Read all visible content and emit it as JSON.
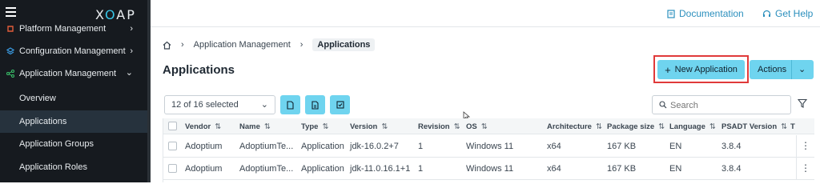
{
  "sidebar": {
    "logo": "XOAP",
    "items": [
      {
        "label": "Platform Management",
        "icon": "platform-icon",
        "color": "#e25c3a"
      },
      {
        "label": "Configuration Management",
        "icon": "layers-icon",
        "color": "#3a9be2"
      },
      {
        "label": "Application Management",
        "icon": "share-icon",
        "color": "#3ac26a"
      },
      {
        "label": "Overview"
      },
      {
        "label": "Applications"
      },
      {
        "label": "Application Groups"
      },
      {
        "label": "Application Roles"
      }
    ]
  },
  "header": {
    "documentation": "Documentation",
    "get_help": "Get Help"
  },
  "breadcrumb": {
    "home_icon": "home-icon",
    "items": [
      "Application Management",
      "Applications"
    ]
  },
  "page": {
    "title": "Applications",
    "new_button": "New Application",
    "actions_button": "Actions"
  },
  "toolbar": {
    "selection": "12 of 16 selected",
    "search_placeholder": "Search"
  },
  "table": {
    "columns": [
      "Vendor",
      "Name",
      "Type",
      "Version",
      "Revision",
      "OS",
      "Architecture",
      "Package size",
      "Language",
      "PSADT Version",
      "T"
    ],
    "rows": [
      [
        "Adoptium",
        "AdoptiumTe...",
        "Application",
        "jdk-16.0.2+7",
        "1",
        "Windows 11",
        "x64",
        "167 KB",
        "EN",
        "3.8.4"
      ],
      [
        "Adoptium",
        "AdoptiumTe...",
        "Application",
        "jdk-11.0.16.1+1",
        "1",
        "Windows 11",
        "x64",
        "167 KB",
        "EN",
        "3.8.4"
      ]
    ]
  },
  "colors": {
    "accent": "#6fd4ef",
    "link": "#2b8fbd",
    "highlight_outline": "#e03a3a",
    "sidebar_bg": "#161a1f"
  }
}
